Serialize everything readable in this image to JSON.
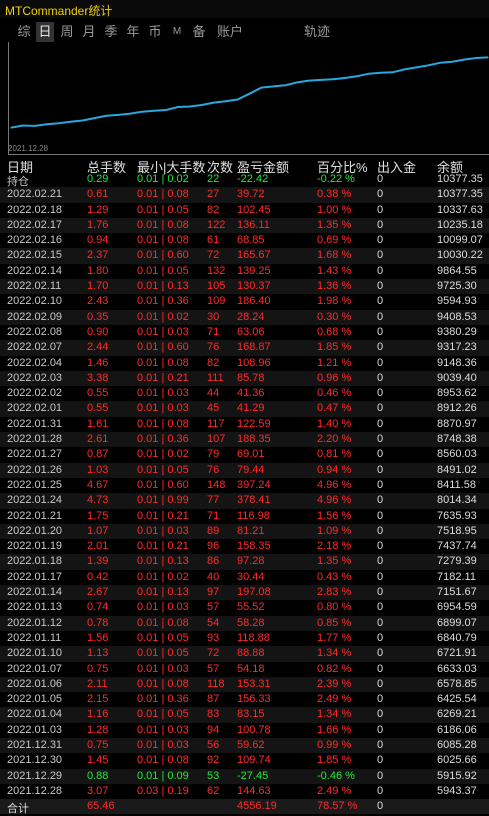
{
  "app": {
    "title": "MTCommander统计"
  },
  "tabs": [
    {
      "label": "综"
    },
    {
      "label": "日"
    },
    {
      "label": "周"
    },
    {
      "label": "月"
    },
    {
      "label": "季"
    },
    {
      "label": "年"
    },
    {
      "label": "币"
    },
    {
      "label": "M"
    },
    {
      "label": "备"
    },
    {
      "label": "账户"
    },
    {
      "label": "轨迹"
    }
  ],
  "active_tab": "日",
  "chart": {
    "start_label": "2021.12.28",
    "line_color": "#29a8e0"
  },
  "colors": {
    "loss": "#ff2a2a",
    "profit": "#22e83a"
  },
  "table": {
    "headers": [
      "日期",
      "总手数",
      "最小|大手数",
      "次数",
      "盈亏金额",
      "百分比%",
      "出入金",
      "余额"
    ],
    "holding": {
      "date": "持仓",
      "lots": "0.29",
      "minmax": "0.01 | 0.02",
      "count": "22",
      "pnl": "-22.42",
      "pct": "-0.22 %",
      "io": "0",
      "balance": "10377.35"
    },
    "rows": [
      {
        "date": "2022.02.21",
        "lots": "0.61",
        "minmax": "0.01 | 0.08",
        "count": "27",
        "pnl": "39.72",
        "pct": "0.38 %",
        "io": "0",
        "balance": "10377.35"
      },
      {
        "date": "2022.02.18",
        "lots": "1.29",
        "minmax": "0.01 | 0.05",
        "count": "82",
        "pnl": "102.45",
        "pct": "1.00 %",
        "io": "0",
        "balance": "10337.63"
      },
      {
        "date": "2022.02.17",
        "lots": "1.76",
        "minmax": "0.01 | 0.08",
        "count": "122",
        "pnl": "136.11",
        "pct": "1.35 %",
        "io": "0",
        "balance": "10235.18"
      },
      {
        "date": "2022.02.16",
        "lots": "0.94",
        "minmax": "0.01 | 0.08",
        "count": "61",
        "pnl": "68.85",
        "pct": "0.69 %",
        "io": "0",
        "balance": "10099.07"
      },
      {
        "date": "2022.02.15",
        "lots": "2.37",
        "minmax": "0.01 | 0.60",
        "count": "72",
        "pnl": "165.67",
        "pct": "1.68 %",
        "io": "0",
        "balance": "10030.22"
      },
      {
        "date": "2022.02.14",
        "lots": "1.80",
        "minmax": "0.01 | 0.05",
        "count": "132",
        "pnl": "139.25",
        "pct": "1.43 %",
        "io": "0",
        "balance": "9864.55"
      },
      {
        "date": "2022.02.11",
        "lots": "1.70",
        "minmax": "0.01 | 0.13",
        "count": "105",
        "pnl": "130.37",
        "pct": "1.36 %",
        "io": "0",
        "balance": "9725.30"
      },
      {
        "date": "2022.02.10",
        "lots": "2.43",
        "minmax": "0.01 | 0.36",
        "count": "109",
        "pnl": "186.40",
        "pct": "1.98 %",
        "io": "0",
        "balance": "9594.93"
      },
      {
        "date": "2022.02.09",
        "lots": "0.35",
        "minmax": "0.01 | 0.02",
        "count": "30",
        "pnl": "28.24",
        "pct": "0.30 %",
        "io": "0",
        "balance": "9408.53"
      },
      {
        "date": "2022.02.08",
        "lots": "0.90",
        "minmax": "0.01 | 0.03",
        "count": "71",
        "pnl": "63.06",
        "pct": "0.68 %",
        "io": "0",
        "balance": "9380.29"
      },
      {
        "date": "2022.02.07",
        "lots": "2.44",
        "minmax": "0.01 | 0.60",
        "count": "76",
        "pnl": "168.87",
        "pct": "1.85 %",
        "io": "0",
        "balance": "9317.23"
      },
      {
        "date": "2022.02.04",
        "lots": "1.46",
        "minmax": "0.01 | 0.08",
        "count": "82",
        "pnl": "108.96",
        "pct": "1.21 %",
        "io": "0",
        "balance": "9148.36"
      },
      {
        "date": "2022.02.03",
        "lots": "3.38",
        "minmax": "0.01 | 0.21",
        "count": "111",
        "pnl": "85.78",
        "pct": "0.96 %",
        "io": "0",
        "balance": "9039.40"
      },
      {
        "date": "2022.02.02",
        "lots": "0.55",
        "minmax": "0.01 | 0.03",
        "count": "44",
        "pnl": "41.36",
        "pct": "0.46 %",
        "io": "0",
        "balance": "8953.62"
      },
      {
        "date": "2022.02.01",
        "lots": "0.55",
        "minmax": "0.01 | 0.03",
        "count": "45",
        "pnl": "41.29",
        "pct": "0.47 %",
        "io": "0",
        "balance": "8912.26"
      },
      {
        "date": "2022.01.31",
        "lots": "1.61",
        "minmax": "0.01 | 0.08",
        "count": "117",
        "pnl": "122.59",
        "pct": "1.40 %",
        "io": "0",
        "balance": "8870.97"
      },
      {
        "date": "2022.01.28",
        "lots": "2.61",
        "minmax": "0.01 | 0.36",
        "count": "107",
        "pnl": "188.35",
        "pct": "2.20 %",
        "io": "0",
        "balance": "8748.38"
      },
      {
        "date": "2022.01.27",
        "lots": "0.87",
        "minmax": "0.01 | 0.02",
        "count": "79",
        "pnl": "69.01",
        "pct": "0.81 %",
        "io": "0",
        "balance": "8560.03"
      },
      {
        "date": "2022.01.26",
        "lots": "1.03",
        "minmax": "0.01 | 0.05",
        "count": "76",
        "pnl": "79.44",
        "pct": "0.94 %",
        "io": "0",
        "balance": "8491.02"
      },
      {
        "date": "2022.01.25",
        "lots": "4.67",
        "minmax": "0.01 | 0.60",
        "count": "148",
        "pnl": "397.24",
        "pct": "4.96 %",
        "io": "0",
        "balance": "8411.58"
      },
      {
        "date": "2022.01.24",
        "lots": "4.73",
        "minmax": "0.01 | 0.99",
        "count": "77",
        "pnl": "378.41",
        "pct": "4.96 %",
        "io": "0",
        "balance": "8014.34"
      },
      {
        "date": "2022.01.21",
        "lots": "1.75",
        "minmax": "0.01 | 0.21",
        "count": "71",
        "pnl": "116.98",
        "pct": "1.56 %",
        "io": "0",
        "balance": "7635.93"
      },
      {
        "date": "2022.01.20",
        "lots": "1.07",
        "minmax": "0.01 | 0.03",
        "count": "89",
        "pnl": "81.21",
        "pct": "1.09 %",
        "io": "0",
        "balance": "7518.95"
      },
      {
        "date": "2022.01.19",
        "lots": "2.01",
        "minmax": "0.01 | 0.21",
        "count": "96",
        "pnl": "158.35",
        "pct": "2.18 %",
        "io": "0",
        "balance": "7437.74"
      },
      {
        "date": "2022.01.18",
        "lots": "1.39",
        "minmax": "0.01 | 0.13",
        "count": "86",
        "pnl": "97.28",
        "pct": "1.35 %",
        "io": "0",
        "balance": "7279.39"
      },
      {
        "date": "2022.01.17",
        "lots": "0.42",
        "minmax": "0.01 | 0.02",
        "count": "40",
        "pnl": "30.44",
        "pct": "0.43 %",
        "io": "0",
        "balance": "7182.11"
      },
      {
        "date": "2022.01.14",
        "lots": "2.67",
        "minmax": "0.01 | 0.13",
        "count": "97",
        "pnl": "197.08",
        "pct": "2.83 %",
        "io": "0",
        "balance": "7151.67"
      },
      {
        "date": "2022.01.13",
        "lots": "0.74",
        "minmax": "0.01 | 0.03",
        "count": "57",
        "pnl": "55.52",
        "pct": "0.80 %",
        "io": "0",
        "balance": "6954.59"
      },
      {
        "date": "2022.01.12",
        "lots": "0.78",
        "minmax": "0.01 | 0.08",
        "count": "54",
        "pnl": "58.28",
        "pct": "0.85 %",
        "io": "0",
        "balance": "6899.07"
      },
      {
        "date": "2022.01.11",
        "lots": "1.56",
        "minmax": "0.01 | 0.05",
        "count": "93",
        "pnl": "118.88",
        "pct": "1.77 %",
        "io": "0",
        "balance": "6840.79"
      },
      {
        "date": "2022.01.10",
        "lots": "1.13",
        "minmax": "0.01 | 0.05",
        "count": "72",
        "pnl": "88.88",
        "pct": "1.34 %",
        "io": "0",
        "balance": "6721.91"
      },
      {
        "date": "2022.01.07",
        "lots": "0.75",
        "minmax": "0.01 | 0.03",
        "count": "57",
        "pnl": "54.18",
        "pct": "0.82 %",
        "io": "0",
        "balance": "6633.03"
      },
      {
        "date": "2022.01.06",
        "lots": "2.11",
        "minmax": "0.01 | 0.08",
        "count": "118",
        "pnl": "153.31",
        "pct": "2.39 %",
        "io": "0",
        "balance": "6578.85"
      },
      {
        "date": "2022.01.05",
        "lots": "2.15",
        "minmax": "0.01 | 0.36",
        "count": "87",
        "pnl": "156.33",
        "pct": "2.49 %",
        "io": "0",
        "balance": "6425.54"
      },
      {
        "date": "2022.01.04",
        "lots": "1.16",
        "minmax": "0.01 | 0.05",
        "count": "83",
        "pnl": "83.15",
        "pct": "1.34 %",
        "io": "0",
        "balance": "6269.21"
      },
      {
        "date": "2022.01.03",
        "lots": "1.28",
        "minmax": "0.01 | 0.03",
        "count": "94",
        "pnl": "100.78",
        "pct": "1.66 %",
        "io": "0",
        "balance": "6186.06"
      },
      {
        "date": "2021.12.31",
        "lots": "0.75",
        "minmax": "0.01 | 0.03",
        "count": "56",
        "pnl": "59.62",
        "pct": "0.99 %",
        "io": "0",
        "balance": "6085.28"
      },
      {
        "date": "2021.12.30",
        "lots": "1.45",
        "minmax": "0.01 | 0.08",
        "count": "92",
        "pnl": "109.74",
        "pct": "1.85 %",
        "io": "0",
        "balance": "6025.66"
      },
      {
        "date": "2021.12.29",
        "lots": "0.88",
        "minmax": "0.01 | 0.09",
        "count": "53",
        "pnl": "-27.45",
        "pct": "-0.46 %",
        "io": "0",
        "balance": "5915.92"
      },
      {
        "date": "2021.12.28",
        "lots": "3.07",
        "minmax": "0.03 | 0.19",
        "count": "62",
        "pnl": "144.63",
        "pct": "2.49 %",
        "io": "0",
        "balance": "5943.37"
      }
    ],
    "total": {
      "date": "合计",
      "lots": "65.46",
      "minmax": "",
      "count": "",
      "pnl": "4556.19",
      "pct": "78.57 %",
      "io": "0",
      "balance": ""
    }
  }
}
